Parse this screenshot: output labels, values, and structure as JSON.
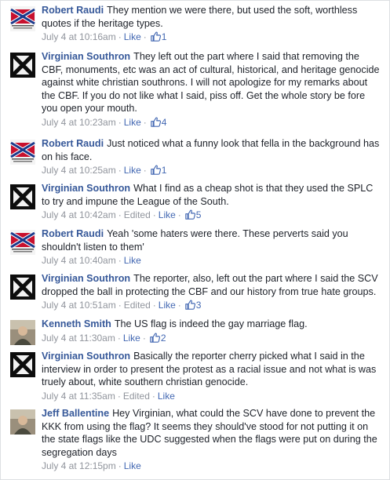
{
  "comments": [
    {
      "author": "Robert Raudi",
      "avatar": "confederate-flag-avatar",
      "text": "They mention we were there, but used the soft, worthless quotes if the heritage types.",
      "time": "July 4 at 10:16am",
      "edited": "",
      "like_label": "Like",
      "likes": "1"
    },
    {
      "author": "Virginian Southron",
      "avatar": "saltire-avatar",
      "text": "They left out the part where I said that removing the CBF, monuments, etc was an act of cultural, historical, and heritage genocide against white christian southrons. I will not apologize for my remarks about the CBF. If you do not like what I said, piss off. Get the whole story be fore you open your mouth.",
      "time": "July 4 at 10:23am",
      "edited": "",
      "like_label": "Like",
      "likes": "4"
    },
    {
      "author": "Robert Raudi",
      "avatar": "confederate-flag-avatar",
      "text": "Just noticed what a funny look that fella in the background has on his face.",
      "time": "July 4 at 10:25am",
      "edited": "",
      "like_label": "Like",
      "likes": "1"
    },
    {
      "author": "Virginian Southron",
      "avatar": "saltire-avatar",
      "text": "What I find as a cheap shot is that they used the SPLC to try and impune the League of the South.",
      "time": "July 4 at 10:42am",
      "edited": "Edited",
      "like_label": "Like",
      "likes": "5"
    },
    {
      "author": "Robert Raudi",
      "avatar": "confederate-flag-avatar",
      "text": "Yeah 'some haters were there. These perverts said you shouldn't listen to them'",
      "time": "July 4 at 10:40am",
      "edited": "",
      "like_label": "Like",
      "likes": ""
    },
    {
      "author": "Virginian Southron",
      "avatar": "saltire-avatar",
      "text": "The reporter, also, left out the part where I said the SCV dropped the ball in protecting the CBF and our history from true hate groups.",
      "time": "July 4 at 10:51am",
      "edited": "Edited",
      "like_label": "Like",
      "likes": "3"
    },
    {
      "author": "Kenneth Smith",
      "avatar": "person-photo-avatar",
      "text": "The US flag is indeed the gay marriage flag.",
      "time": "July 4 at 11:30am",
      "edited": "",
      "like_label": "Like",
      "likes": "2"
    },
    {
      "author": "Virginian Southron",
      "avatar": "saltire-avatar",
      "text": "Basically the reporter cherry picked what I said in the interview in order to present the protest as a racial issue and not what is was truely about, white southern christian genocide.",
      "time": "July 4 at 11:35am",
      "edited": "Edited",
      "like_label": "Like",
      "likes": ""
    },
    {
      "author": "Jeff Ballentine",
      "avatar": "person-photo-avatar",
      "text": "Hey Virginian, what could the SCV have done to prevent the KKK from using the flag? It seems they should've stood for not putting it on the state flags like the UDC suggested when the flags were put on during the segregation days",
      "time": "July 4 at 12:15pm",
      "edited": "",
      "like_label": "Like",
      "likes": ""
    }
  ],
  "colors": {
    "name": "#365899",
    "link": "#4267b2",
    "meta": "#90949c",
    "text": "#1d2129"
  }
}
